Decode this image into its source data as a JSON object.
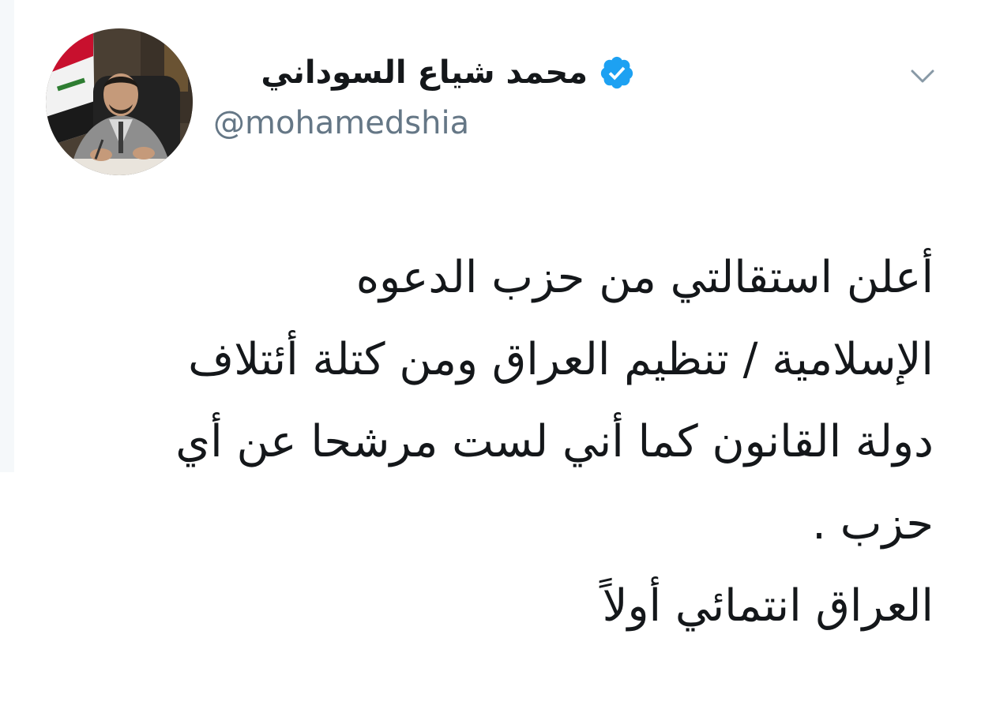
{
  "tweet": {
    "author": {
      "display_name": "محمد شياع السوداني",
      "handle": "@mohamedshia",
      "verified": true,
      "avatar_icon": "profile-photo"
    },
    "menu_icon": "chevron-down-icon",
    "text_lines": [
      "أعلن استقالتي من حزب الدعوه",
      "الإسلامية / تنظيم العراق ومن كتلة أئتلاف",
      "دولة القانون كما أني لست مرشحا عن أي",
      "حزب .",
      "العراق انتمائي أولاً"
    ]
  },
  "colors": {
    "text": "#14171a",
    "handle": "#657786",
    "verified_badge": "#1da1f2",
    "chevron": "#8899a6",
    "background": "#ffffff"
  }
}
